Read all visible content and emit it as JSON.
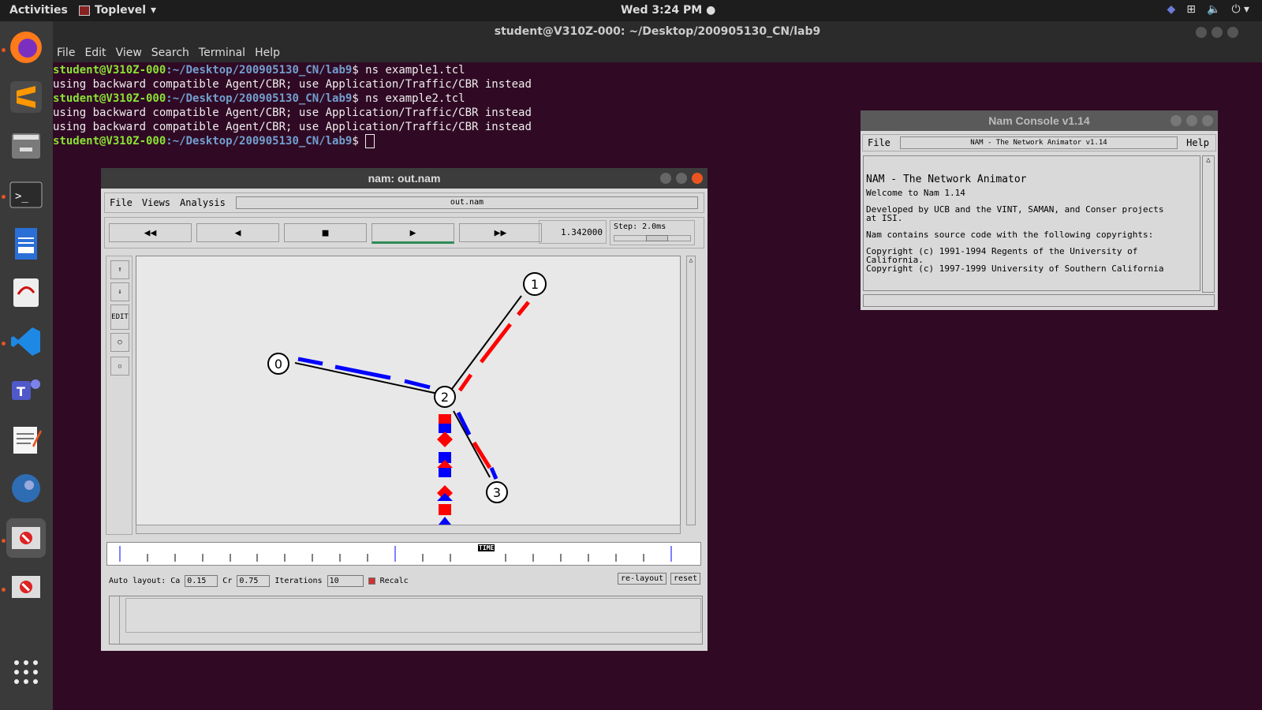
{
  "topbar": {
    "activities": "Activities",
    "app": "Toplevel",
    "clock": "Wed  3:24 PM"
  },
  "terminal": {
    "title": "student@V310Z-000: ~/Desktop/200905130_CN/lab9",
    "menu": [
      "File",
      "Edit",
      "View",
      "Search",
      "Terminal",
      "Help"
    ],
    "user": "student@V310Z-000",
    "path": ":~/Desktop/200905130_CN/lab9",
    "lines": [
      {
        "type": "prompt",
        "cmd": "$ ns example1.tcl"
      },
      {
        "type": "out",
        "text": "using backward compatible Agent/CBR; use Application/Traffic/CBR instead"
      },
      {
        "type": "prompt",
        "cmd": "$ ns example2.tcl"
      },
      {
        "type": "out",
        "text": "using backward compatible Agent/CBR; use Application/Traffic/CBR instead"
      },
      {
        "type": "out",
        "text": "using backward compatible Agent/CBR; use Application/Traffic/CBR instead"
      },
      {
        "type": "prompt",
        "cmd": "$ "
      }
    ]
  },
  "nam": {
    "title": "nam: out.nam",
    "menu": [
      "File",
      "Views",
      "Analysis"
    ],
    "file_field": "out.nam",
    "time": "1.342000",
    "step": "Step: 2.0ms",
    "edit_label": "EDIT",
    "nodes": [
      "0",
      "1",
      "2",
      "3"
    ],
    "timeline_label": "TIME",
    "auto_layout": "Auto layout:",
    "ca_label": "Ca",
    "ca_value": "0.15",
    "cr_label": "Cr",
    "cr_value": "0.75",
    "iter_label": "Iterations",
    "iter_value": "10",
    "recalc": "Recalc",
    "relayout": "re-layout",
    "reset": "reset"
  },
  "console": {
    "title": "Nam Console v1.14",
    "menu_file": "File",
    "menu_help": "Help",
    "field": "NAM - The Network Animator v1.14",
    "lines": [
      "NAM - The Network Animator",
      "Welcome to Nam 1.14",
      "Developed by UCB and the VINT, SAMAN, and Conser projects",
      "at ISI.",
      "Nam contains source code with the following copyrights:",
      "Copyright (c) 1991-1994 Regents of the University of",
      "California.",
      "Copyright (c) 1997-1999 University of Southern California"
    ]
  },
  "colors": {
    "blue": "#0000ff",
    "red": "#ff0000",
    "prompt_user": "#8ae234",
    "prompt_path": "#729fcf"
  }
}
